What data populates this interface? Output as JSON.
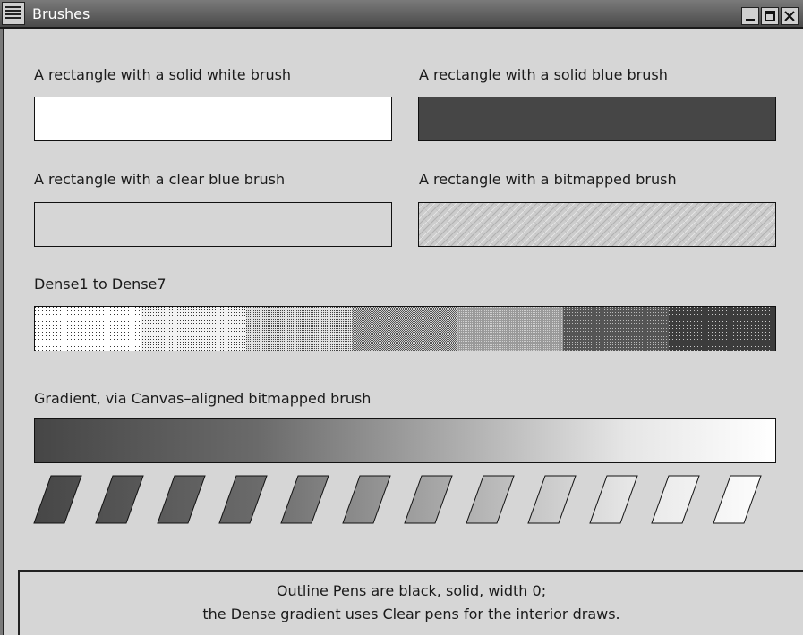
{
  "window": {
    "title": "Brushes",
    "controls": [
      "minimize",
      "maximize",
      "close"
    ]
  },
  "labels": {
    "solid_white": "A rectangle with a solid white brush",
    "solid_blue": "A rectangle with a solid blue brush",
    "clear_blue": "A rectangle with a clear blue brush",
    "bitmapped": "A rectangle with a bitmapped brush",
    "dense": "Dense1 to Dense7",
    "gradient": "Gradient, via Canvas–aligned bitmapped brush"
  },
  "dense_patterns": [
    "Dense1",
    "Dense2",
    "Dense3",
    "Dense4",
    "Dense5",
    "Dense6",
    "Dense7"
  ],
  "status": {
    "line1": "Outline Pens are black, solid, width 0;",
    "line2": "the Dense gradient uses Clear pens for the interior draws."
  },
  "colors": {
    "background": "#d6d6d6",
    "solid_white": "#ffffff",
    "solid_blue_rendered": "#464646",
    "gradient_start": "#464646",
    "gradient_end": "#ffffff"
  }
}
